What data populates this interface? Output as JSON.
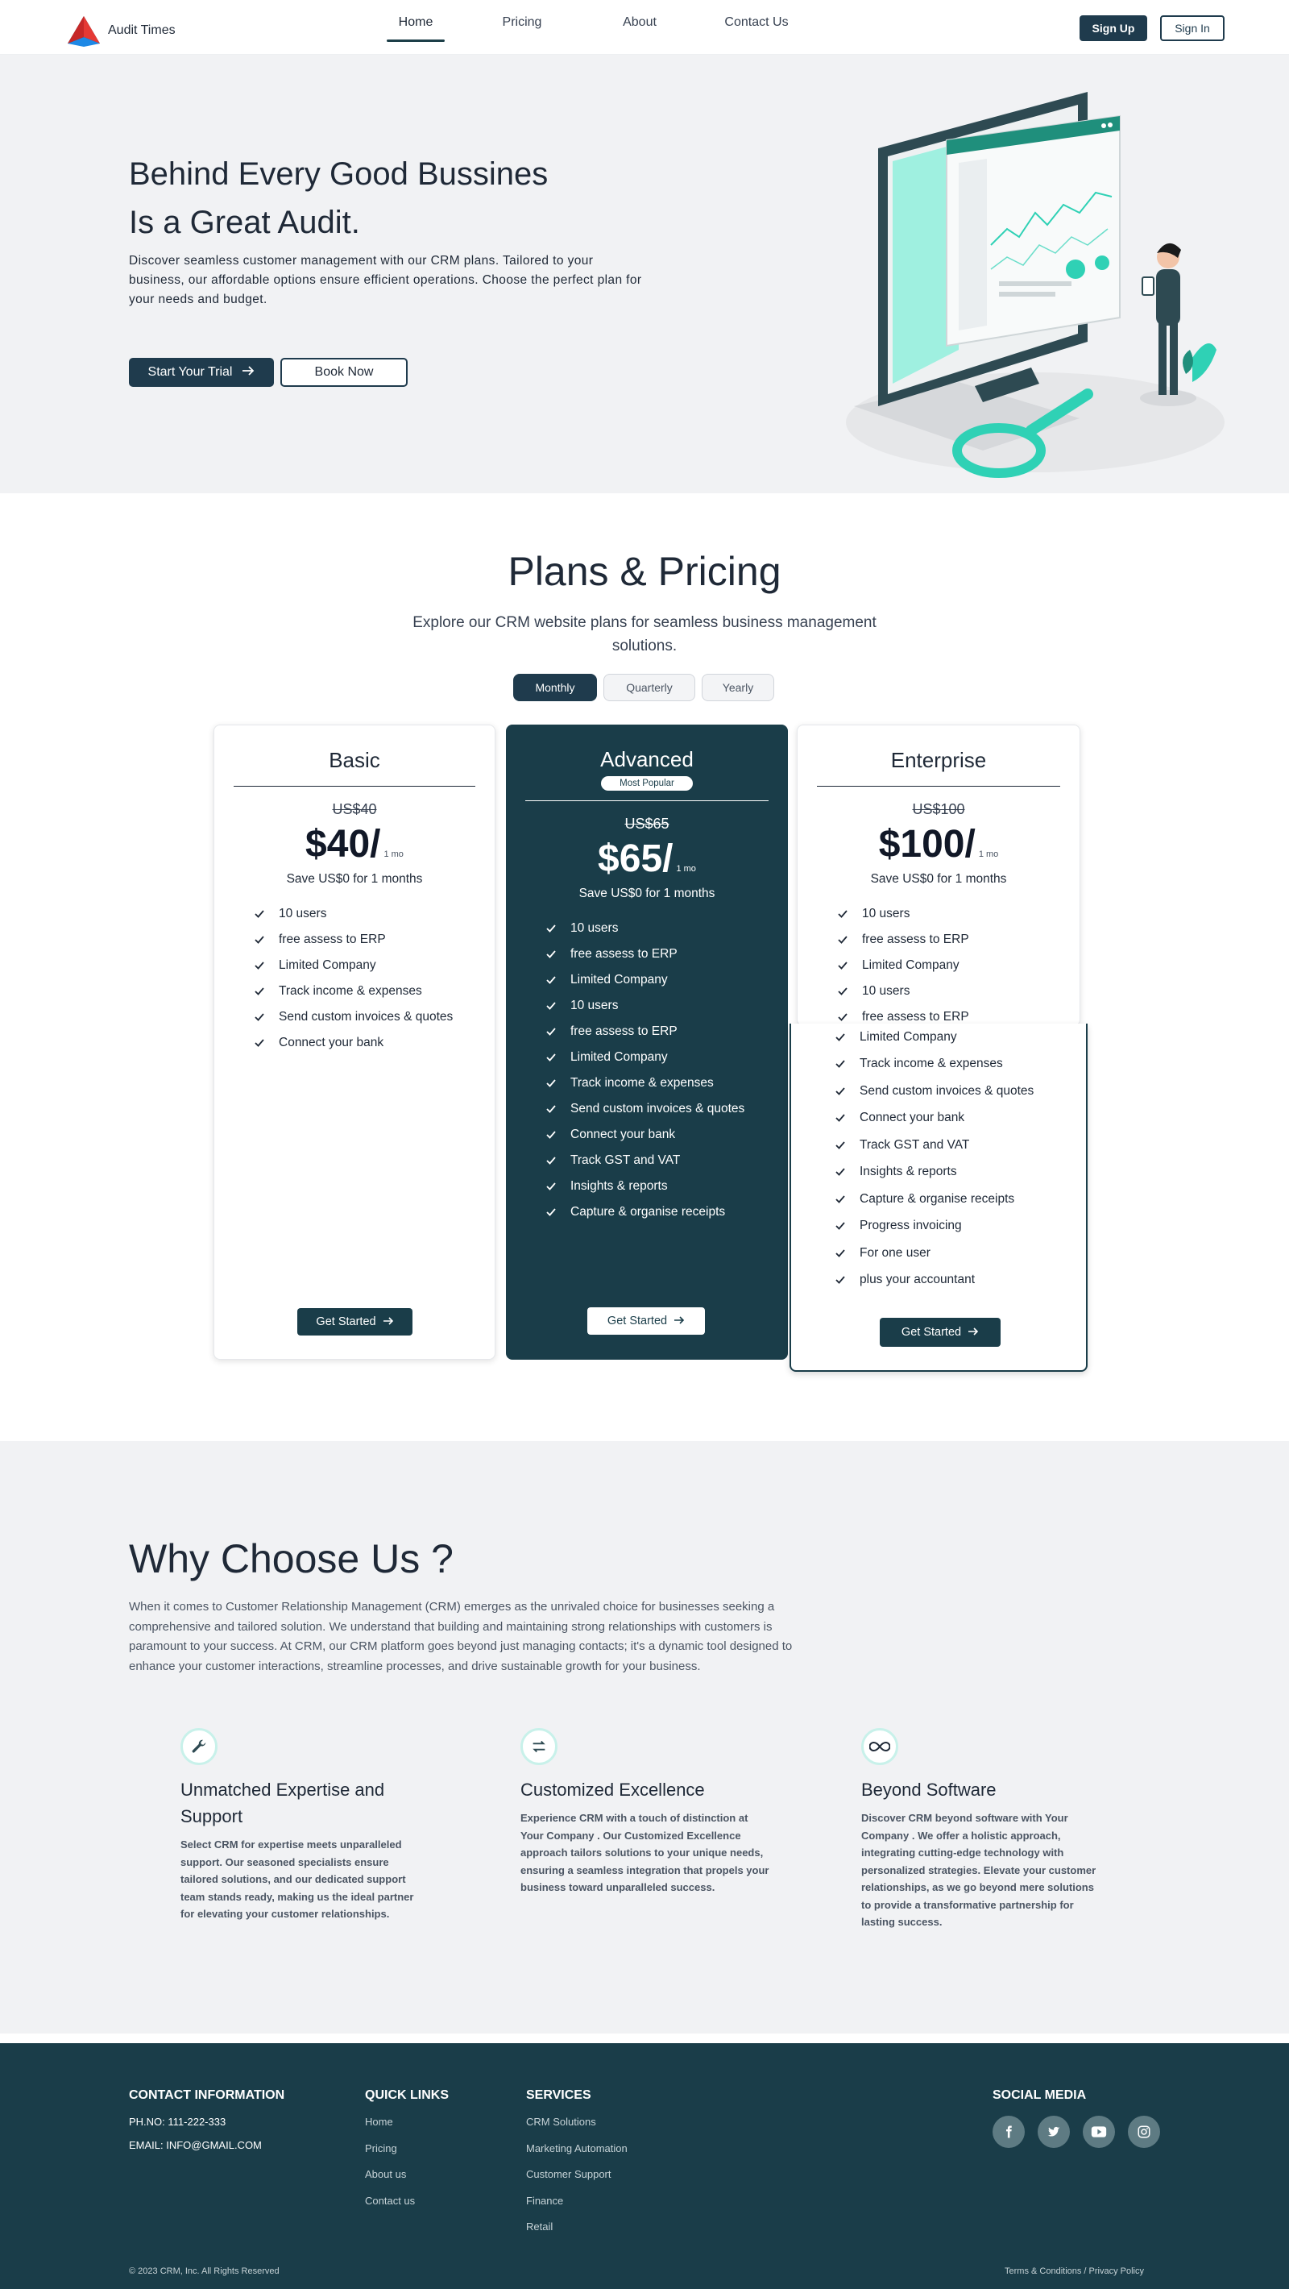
{
  "nav": {
    "brand": "Audit Times",
    "links": [
      "Home",
      "Pricing",
      "About",
      "Contact Us"
    ],
    "active": "Home",
    "signup": "Sign Up",
    "signin": "Sign In"
  },
  "hero": {
    "title_line1": "Behind Every Good Bussines",
    "title_line2": "Is a Great Audit.",
    "description": "Discover seamless customer management with our CRM plans. Tailored to your business, our affordable options ensure efficient operations. Choose the perfect plan for your needs and budget.",
    "primary_cta": "Start Your Trial",
    "secondary_cta": "Book Now"
  },
  "pricing": {
    "title": "Plans & Pricing",
    "subtitle": "Explore our CRM website plans for seamless business management solutions.",
    "periods": [
      "Monthly",
      "Quarterly",
      "Yearly"
    ],
    "active_period": "Monthly",
    "plans": [
      {
        "name": "Basic",
        "old_price": "US$40",
        "price": "$40/",
        "per": "1 mo",
        "save": "Save US$0 for 1 months",
        "features": [
          "10 users",
          "free assess to ERP",
          "Limited Company",
          "Track income & expenses",
          "Send custom invoices & quotes",
          "Connect your bank"
        ],
        "cta": "Get Started"
      },
      {
        "name": "Advanced",
        "badge": "Most Popular",
        "old_price": "US$65",
        "price": "$65/",
        "per": "1 mo",
        "save": "Save US$0 for 1 months",
        "features": [
          "10 users",
          "free assess to ERP",
          "Limited Company",
          "10 users",
          "free assess to ERP",
          "Limited Company",
          "Track income & expenses",
          "Send custom invoices & quotes",
          "Connect your bank",
          "Track GST and VAT",
          "Insights & reports",
          "Capture & organise receipts"
        ],
        "cta": "Get Started"
      },
      {
        "name": "Enterprise",
        "old_price": "US$100",
        "price": "$100/",
        "per": "1 mo",
        "save": "Save US$0 for 1 months",
        "features": [
          "10 users",
          "free assess to ERP",
          "Limited Company",
          "10 users",
          "free assess to ERP",
          "Limited Company",
          "Track income & expenses",
          "Send custom invoices & quotes",
          "Connect your bank",
          "Track GST and VAT",
          "Insights & reports",
          "Capture & organise receipts",
          "Progress invoicing",
          "For one user",
          "plus your accountant"
        ],
        "cta": "Get Started"
      }
    ]
  },
  "why": {
    "title": "Why Choose Us ?",
    "description": "When it comes to Customer Relationship Management (CRM) emerges as the unrivaled choice for businesses seeking a comprehensive and tailored solution. We understand that building and maintaining strong relationships with customers is paramount to your success. At CRM, our CRM platform goes beyond just managing contacts; it's a dynamic tool designed to enhance your customer interactions, streamline processes, and drive sustainable growth for your business.",
    "features": [
      {
        "icon": "wrench-icon",
        "title": "Unmatched Expertise and Support",
        "text": "Select CRM for expertise meets unparalleled support. Our seasoned specialists ensure tailored solutions, and our dedicated support team stands ready, making us the ideal partner for elevating your customer relationships."
      },
      {
        "icon": "exchange-icon",
        "title": "Customized Excellence",
        "text": "Experience CRM with a touch of distinction at Your Company . Our Customized Excellence approach tailors solutions to your unique needs, ensuring a seamless integration that propels your business toward unparalleled success."
      },
      {
        "icon": "infinity-icon",
        "title": "Beyond Software",
        "text": "Discover CRM beyond software with Your Company . We offer a holistic approach, integrating cutting-edge technology with personalized strategies. Elevate your customer relationships, as we go beyond mere solutions to provide a transformative partnership for lasting success."
      }
    ]
  },
  "footer": {
    "contact_title": "CONTACT INFORMATION",
    "phone": "PH.NO: 111-222-333",
    "email": "EMAIL: INFO@GMAIL.COM",
    "quick_title": "QUICK LINKS",
    "quick_links": [
      "Home",
      "Pricing",
      "About us",
      "Contact us"
    ],
    "services_title": "SERVICES",
    "services": [
      "CRM Solutions",
      "Marketing Automation",
      "Customer Support",
      "Finance",
      "Retail"
    ],
    "social_title": "SOCIAL MEDIA",
    "social": [
      "facebook-icon",
      "twitter-icon",
      "youtube-icon",
      "instagram-icon"
    ],
    "copyright": "© 2023 CRM, Inc. All Rights Reserved",
    "legal": "Terms & Conditions / Privacy Policy"
  },
  "colors": {
    "primary_dark": "#1a3d49",
    "button_dark": "#1f3b4d",
    "accent_teal": "#2fd1b5",
    "section_bg": "#f1f2f4"
  }
}
